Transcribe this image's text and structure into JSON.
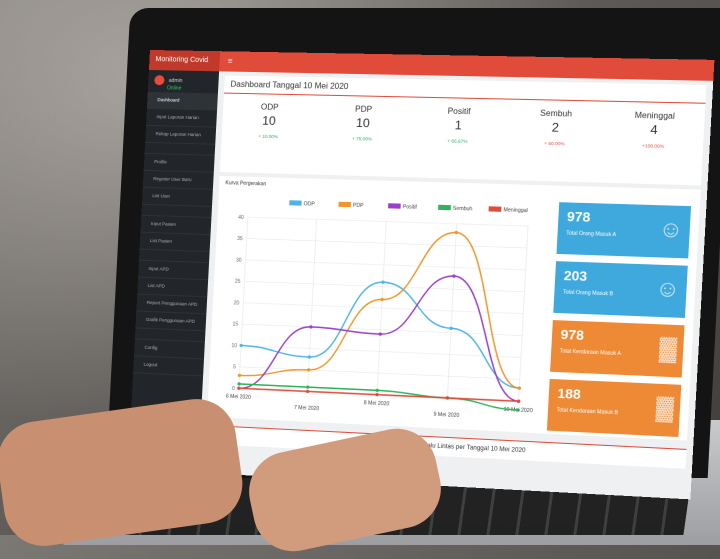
{
  "app": {
    "brand": "Monitoring Covid",
    "user_name": "admin",
    "user_status": "Online",
    "menu_icon": "hamburger-icon"
  },
  "sidebar": {
    "items": [
      {
        "label": "Dashboard",
        "type": "item",
        "active": true
      },
      {
        "label": "Input Laporan Harian",
        "type": "item"
      },
      {
        "label": "Rekap Laporan Harian",
        "type": "item"
      },
      {
        "label": "",
        "type": "hdr"
      },
      {
        "label": "Profile",
        "type": "item"
      },
      {
        "label": "Register User Baru",
        "type": "item"
      },
      {
        "label": "List User",
        "type": "item"
      },
      {
        "label": "",
        "type": "hdr"
      },
      {
        "label": "Input Pasien",
        "type": "item"
      },
      {
        "label": "List Pasien",
        "type": "item"
      },
      {
        "label": "",
        "type": "hdr"
      },
      {
        "label": "Input APD",
        "type": "item"
      },
      {
        "label": "List APD",
        "type": "item"
      },
      {
        "label": "Report Penggunaan APD",
        "type": "item"
      },
      {
        "label": "Grafik Penggunaan APD",
        "type": "item"
      },
      {
        "label": "",
        "type": "hdr"
      },
      {
        "label": "Config",
        "type": "item"
      },
      {
        "label": "Logout",
        "type": "item"
      }
    ]
  },
  "dashboard": {
    "title": "Dashboard Tanggal 10 Mei 2020",
    "stats": [
      {
        "label": "ODP",
        "value": "10",
        "change": "+ 10.00%",
        "dir": "up"
      },
      {
        "label": "PDP",
        "value": "10",
        "change": "+ 75.00%",
        "dir": "up"
      },
      {
        "label": "Positif",
        "value": "1",
        "change": "+ 66.67%",
        "dir": "up"
      },
      {
        "label": "Sembuh",
        "value": "2",
        "change": "+ 60.00%",
        "dir": "down"
      },
      {
        "label": "Meninggal",
        "value": "4",
        "change": "+100.00%",
        "dir": "down"
      }
    ],
    "chart_title": "Kurva Pergerakan",
    "cards": [
      {
        "value": "978",
        "label": "Total Orang Masuk A",
        "color": "#3fa9de",
        "icon": "user-plus-icon"
      },
      {
        "value": "203",
        "label": "Total Orang Masuk B",
        "color": "#3fa9de",
        "icon": "user-plus-icon"
      },
      {
        "value": "978",
        "label": "Total Kendaraan Masuk A",
        "color": "#ee8a36",
        "icon": "bar-chart-icon"
      },
      {
        "value": "188",
        "label": "Total Kendaraan Masuk B",
        "color": "#ee8a36",
        "icon": "bar-chart-icon"
      }
    ],
    "footer_title": "Detail Pergerakan Arus Lalu Lintas per Tanggal 10 Mei 2020"
  },
  "chart_data": {
    "type": "line",
    "x": [
      "6 Mei 2020",
      "7 Mei 2020",
      "8 Mei 2020",
      "9 Mei 2020",
      "10 Mei 2020"
    ],
    "ylim": [
      0,
      40
    ],
    "yticks": [
      0,
      5,
      10,
      15,
      20,
      25,
      30,
      35,
      40
    ],
    "legend_position": "top",
    "grid": true,
    "series": [
      {
        "name": "ODP",
        "color": "#4fb3e8",
        "values": [
          10,
          8,
          26,
          16,
          3
        ]
      },
      {
        "name": "PDP",
        "color": "#f0962b",
        "values": [
          3,
          5,
          22,
          38,
          3
        ]
      },
      {
        "name": "Positif",
        "color": "#9b3fc8",
        "values": [
          0,
          15,
          14,
          28,
          0
        ]
      },
      {
        "name": "Sembuh",
        "color": "#2db35a",
        "values": [
          1,
          1,
          1,
          0,
          -2
        ]
      },
      {
        "name": "Meninggal",
        "color": "#e04b3a",
        "values": [
          0,
          0,
          0,
          0,
          0
        ]
      }
    ]
  }
}
